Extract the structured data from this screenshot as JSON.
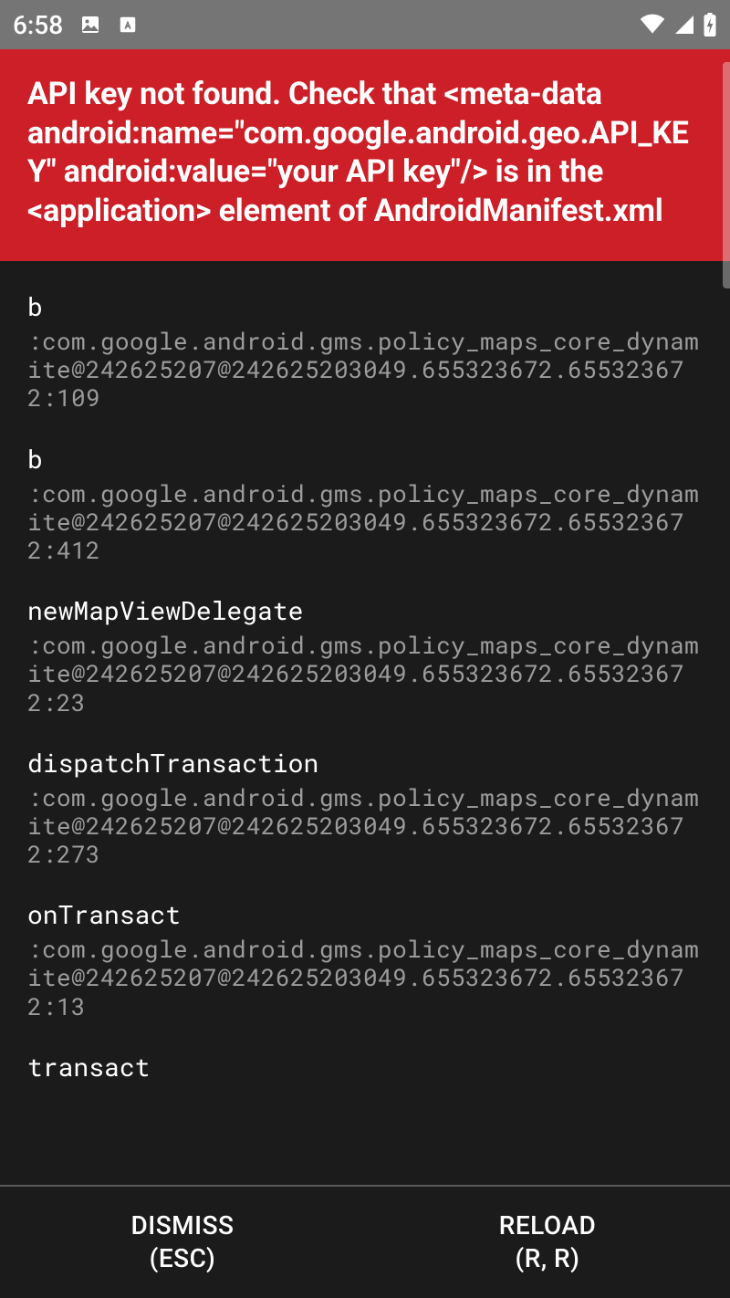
{
  "status_bar": {
    "time": "6:58"
  },
  "error": {
    "message": "API key not found.  Check that <meta-data android:name=\"com.google.android.geo.API_KEY\" android:value=\"your API key\"/> is in the <application> element of AndroidManifest.xml"
  },
  "stack": [
    {
      "method": "b",
      "location": ":com.google.android.gms.policy_maps_core_dynamite@242625207@242625203049.655323672.655323672:109"
    },
    {
      "method": "b",
      "location": ":com.google.android.gms.policy_maps_core_dynamite@242625207@242625203049.655323672.655323672:412"
    },
    {
      "method": "newMapViewDelegate",
      "location": ":com.google.android.gms.policy_maps_core_dynamite@242625207@242625203049.655323672.655323672:23"
    },
    {
      "method": "dispatchTransaction",
      "location": ":com.google.android.gms.policy_maps_core_dynamite@242625207@242625203049.655323672.655323672:273"
    },
    {
      "method": "onTransact",
      "location": ":com.google.android.gms.policy_maps_core_dynamite@242625207@242625203049.655323672.655323672:13"
    },
    {
      "method": "transact",
      "location": ""
    }
  ],
  "footer": {
    "dismiss_label": "DISMISS",
    "dismiss_hint": "(ESC)",
    "reload_label": "RELOAD",
    "reload_hint": "(R, R)"
  }
}
